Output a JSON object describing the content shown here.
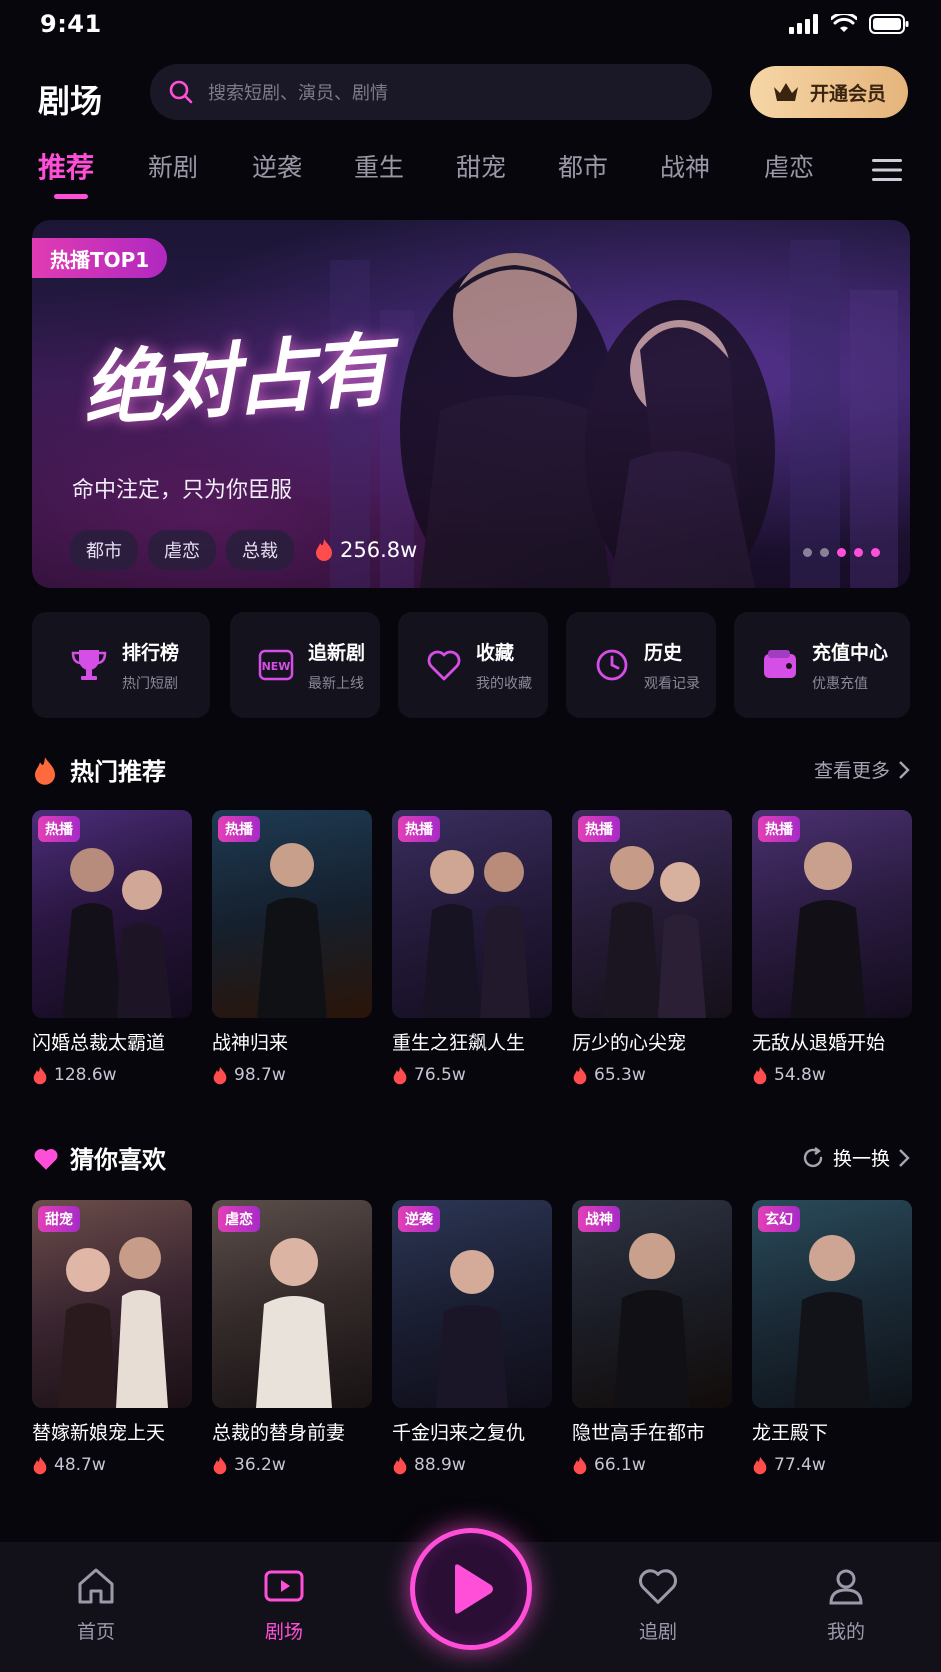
{
  "status": {
    "time": "9:41"
  },
  "header": {
    "title": "剧场",
    "search_placeholder": "搜索短剧、演员、剧情",
    "vip_label": "开通会员"
  },
  "categories": [
    "推荐",
    "新剧",
    "逆袭",
    "重生",
    "甜宠",
    "都市",
    "战神",
    "虐恋"
  ],
  "banner": {
    "badge": "热播TOP1",
    "title": "绝对占有",
    "subtitle": "命中注定，只为你臣服",
    "tags": [
      "都市",
      "虐恋",
      "总裁"
    ],
    "heat": "256.8w"
  },
  "quick_entries": [
    {
      "title": "排行榜",
      "sub": "热门短剧"
    },
    {
      "title": "追新剧",
      "sub": "最新上线"
    },
    {
      "title": "收藏",
      "sub": "我的收藏"
    },
    {
      "title": "历史",
      "sub": "观看记录"
    },
    {
      "title": "充值中心",
      "sub": "优惠充值"
    }
  ],
  "hot": {
    "title": "热门推荐",
    "more": "查看更多",
    "items": [
      {
        "tag": "热播",
        "name": "闪婚总裁太霸道",
        "heat": "128.6w"
      },
      {
        "tag": "热播",
        "name": "战神归来",
        "heat": "98.7w"
      },
      {
        "tag": "热播",
        "name": "重生之狂飙人生",
        "heat": "76.5w"
      },
      {
        "tag": "热播",
        "name": "厉少的心尖宠",
        "heat": "65.3w"
      },
      {
        "tag": "热播",
        "name": "无敌从退婚开始",
        "heat": "54.8w"
      }
    ]
  },
  "guess": {
    "title": "猜你喜欢",
    "more": "换一换",
    "items": [
      {
        "tag": "甜宠",
        "name": "替嫁新娘宠上天",
        "heat": "48.7w"
      },
      {
        "tag": "虐恋",
        "name": "总裁的替身前妻",
        "heat": "36.2w"
      },
      {
        "tag": "逆袭",
        "name": "千金归来之复仇",
        "heat": "88.9w"
      },
      {
        "tag": "战神",
        "name": "隐世高手在都市",
        "heat": "66.1w"
      },
      {
        "tag": "玄幻",
        "name": "龙王殿下",
        "heat": "77.4w"
      }
    ]
  },
  "nav": {
    "home": "首页",
    "theater": "剧场",
    "follow": "追剧",
    "mine": "我的"
  },
  "colors": {
    "accent": "#ff4fd8",
    "vip_gold": "#e5b47b",
    "background": "#07060c"
  }
}
